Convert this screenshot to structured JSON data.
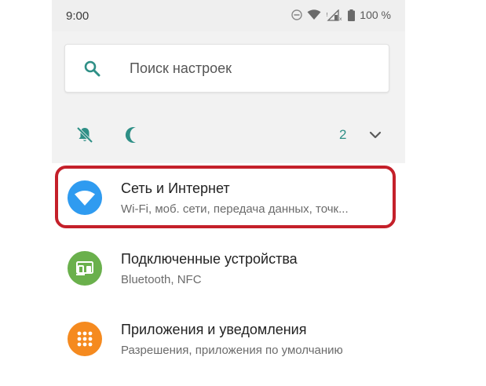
{
  "status_bar": {
    "time": "9:00",
    "battery": "100 %",
    "icons": [
      "dnd-icon",
      "wifi-icon",
      "signal-icon",
      "battery-icon"
    ]
  },
  "search": {
    "placeholder": "Поиск настроек",
    "icon": "search-icon"
  },
  "conditions": {
    "icons": [
      "bell-off-icon",
      "moon-icon"
    ],
    "count": "2",
    "expand_icon": "chevron-down-icon"
  },
  "settings": {
    "items": [
      {
        "title": "Сеть и Интернет",
        "subtitle": "Wi-Fi, моб. сети, передача данных, точк...",
        "icon": "wifi-icon",
        "color": "#2f9bf0"
      },
      {
        "title": "Подключенные устройства",
        "subtitle": "Bluetooth, NFC",
        "icon": "devices-icon",
        "color": "#6ab04c"
      },
      {
        "title": "Приложения и уведомления",
        "subtitle": "Разрешения, приложения по умолчанию",
        "icon": "apps-icon",
        "color": "#f58a1f"
      }
    ]
  },
  "colors": {
    "accent": "#2e8f86",
    "highlight": "#c4202a"
  }
}
